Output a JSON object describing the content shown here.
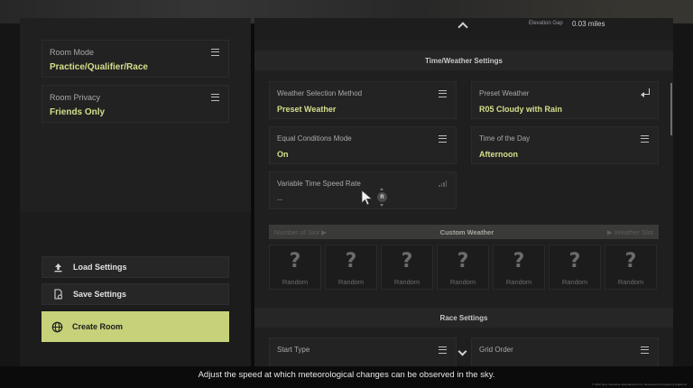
{
  "left_panel": {
    "room_mode": {
      "label": "Room Mode",
      "value": "Practice/Qualifier/Race"
    },
    "room_privacy": {
      "label": "Room Privacy",
      "value": "Friends Only"
    },
    "load_settings": "Load Settings",
    "save_settings": "Save Settings",
    "create_room": "Create Room"
  },
  "right_panel": {
    "elevation_gap": {
      "label": "Elevation Gap",
      "value": "0.03 miles"
    },
    "time_weather_header": "Time/Weather Settings",
    "weather_selection": {
      "label": "Weather Selection Method",
      "value": "Preset Weather"
    },
    "preset_weather": {
      "label": "Preset Weather",
      "value": "R05 Cloudy with Rain"
    },
    "equal_conditions": {
      "label": "Equal Conditions Mode",
      "value": "On"
    },
    "time_of_day": {
      "label": "Time of the Day",
      "value": "Afternoon"
    },
    "variable_time": {
      "label": "Variable Time Speed Rate",
      "value": "--"
    },
    "custom_weather": {
      "left": "Number of Slot ▶",
      "title": "Custom Weather",
      "right": "▶ Weather Slot",
      "slots": [
        "Random",
        "Random",
        "Random",
        "Random",
        "Random",
        "Random",
        "Random"
      ]
    },
    "race_header": "Race Settings",
    "start_type": {
      "label": "Start Type"
    },
    "grid_order": {
      "label": "Grid Order"
    }
  },
  "controller_badge": "R",
  "hint_text": "Adjust the speed at which meteorological changes can be observed in the sky.",
  "copyright": "© 2022 Sony Interactive Entertainment Inc. Developed by Polyphony Digital Inc.",
  "colors": {
    "accent": "#c6d17a",
    "value_text": "#d6df8c"
  },
  "icons": [
    "menu-icon",
    "return-icon",
    "signal-icon",
    "upload-icon",
    "save-file-icon",
    "globe-icon",
    "question-icon",
    "chevron-up-icon",
    "chevron-down-icon",
    "cursor-icon"
  ]
}
